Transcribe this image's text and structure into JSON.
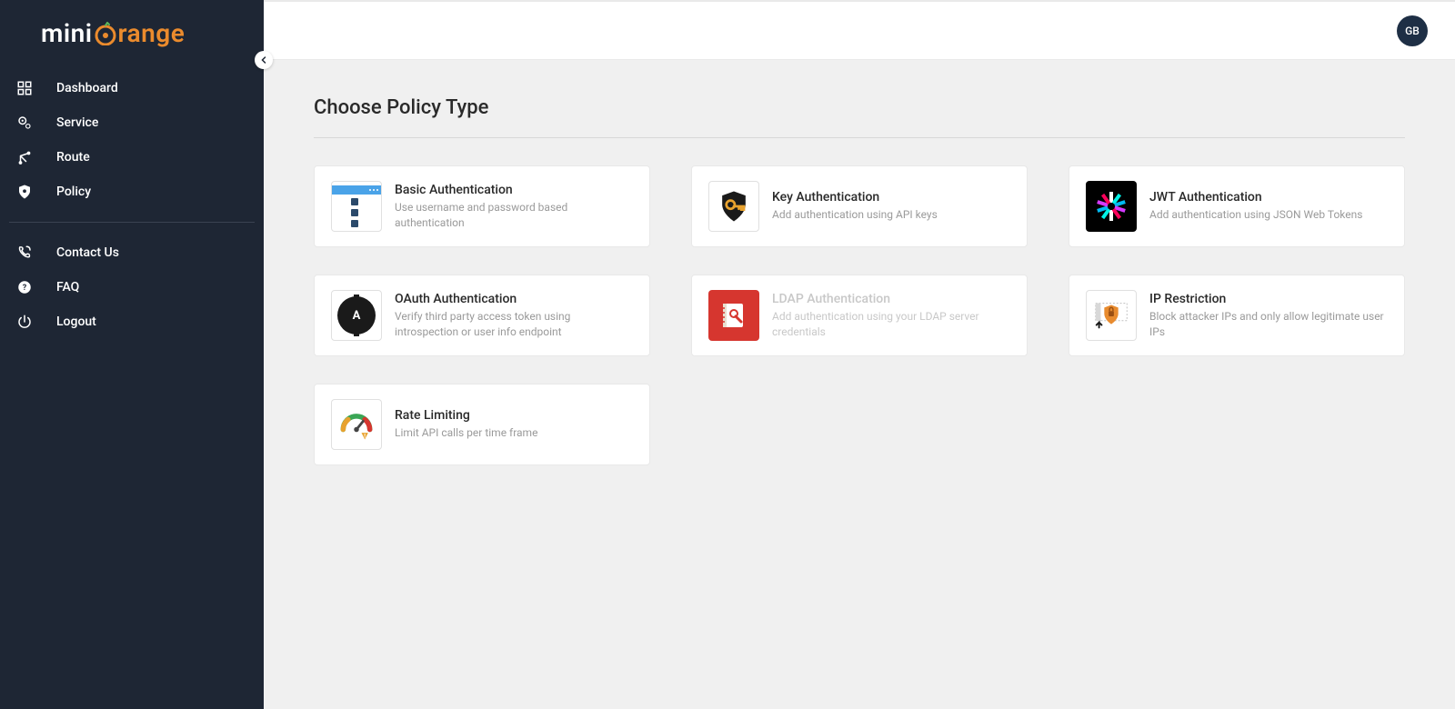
{
  "brand": {
    "name_pre": "mini",
    "name_post": "range"
  },
  "sidebar": {
    "items": [
      {
        "label": "Dashboard",
        "icon": "dashboard"
      },
      {
        "label": "Service",
        "icon": "service"
      },
      {
        "label": "Route",
        "icon": "route"
      },
      {
        "label": "Policy",
        "icon": "policy"
      }
    ],
    "secondary": [
      {
        "label": "Contact Us",
        "icon": "phone"
      },
      {
        "label": "FAQ",
        "icon": "help"
      },
      {
        "label": "Logout",
        "icon": "logout"
      }
    ]
  },
  "header": {
    "avatar_initials": "GB"
  },
  "page": {
    "title": "Choose Policy Type"
  },
  "policies": [
    {
      "id": "basic",
      "title": "Basic Authentication",
      "desc": "Use username and password based authentication"
    },
    {
      "id": "key",
      "title": "Key Authentication",
      "desc": "Add authentication using API keys"
    },
    {
      "id": "jwt",
      "title": "JWT Authentication",
      "desc": "Add authentication using JSON Web Tokens"
    },
    {
      "id": "oauth",
      "title": "OAuth Authentication",
      "desc": "Verify third party access token using introspection or user info endpoint"
    },
    {
      "id": "ldap",
      "title": "LDAP Authentication",
      "desc": "Add authentication using your LDAP server credentials",
      "hovered": true
    },
    {
      "id": "ip",
      "title": "IP Restriction",
      "desc": "Block attacker IPs and only allow legitimate user IPs"
    },
    {
      "id": "rate",
      "title": "Rate Limiting",
      "desc": "Limit API calls per time frame"
    }
  ]
}
